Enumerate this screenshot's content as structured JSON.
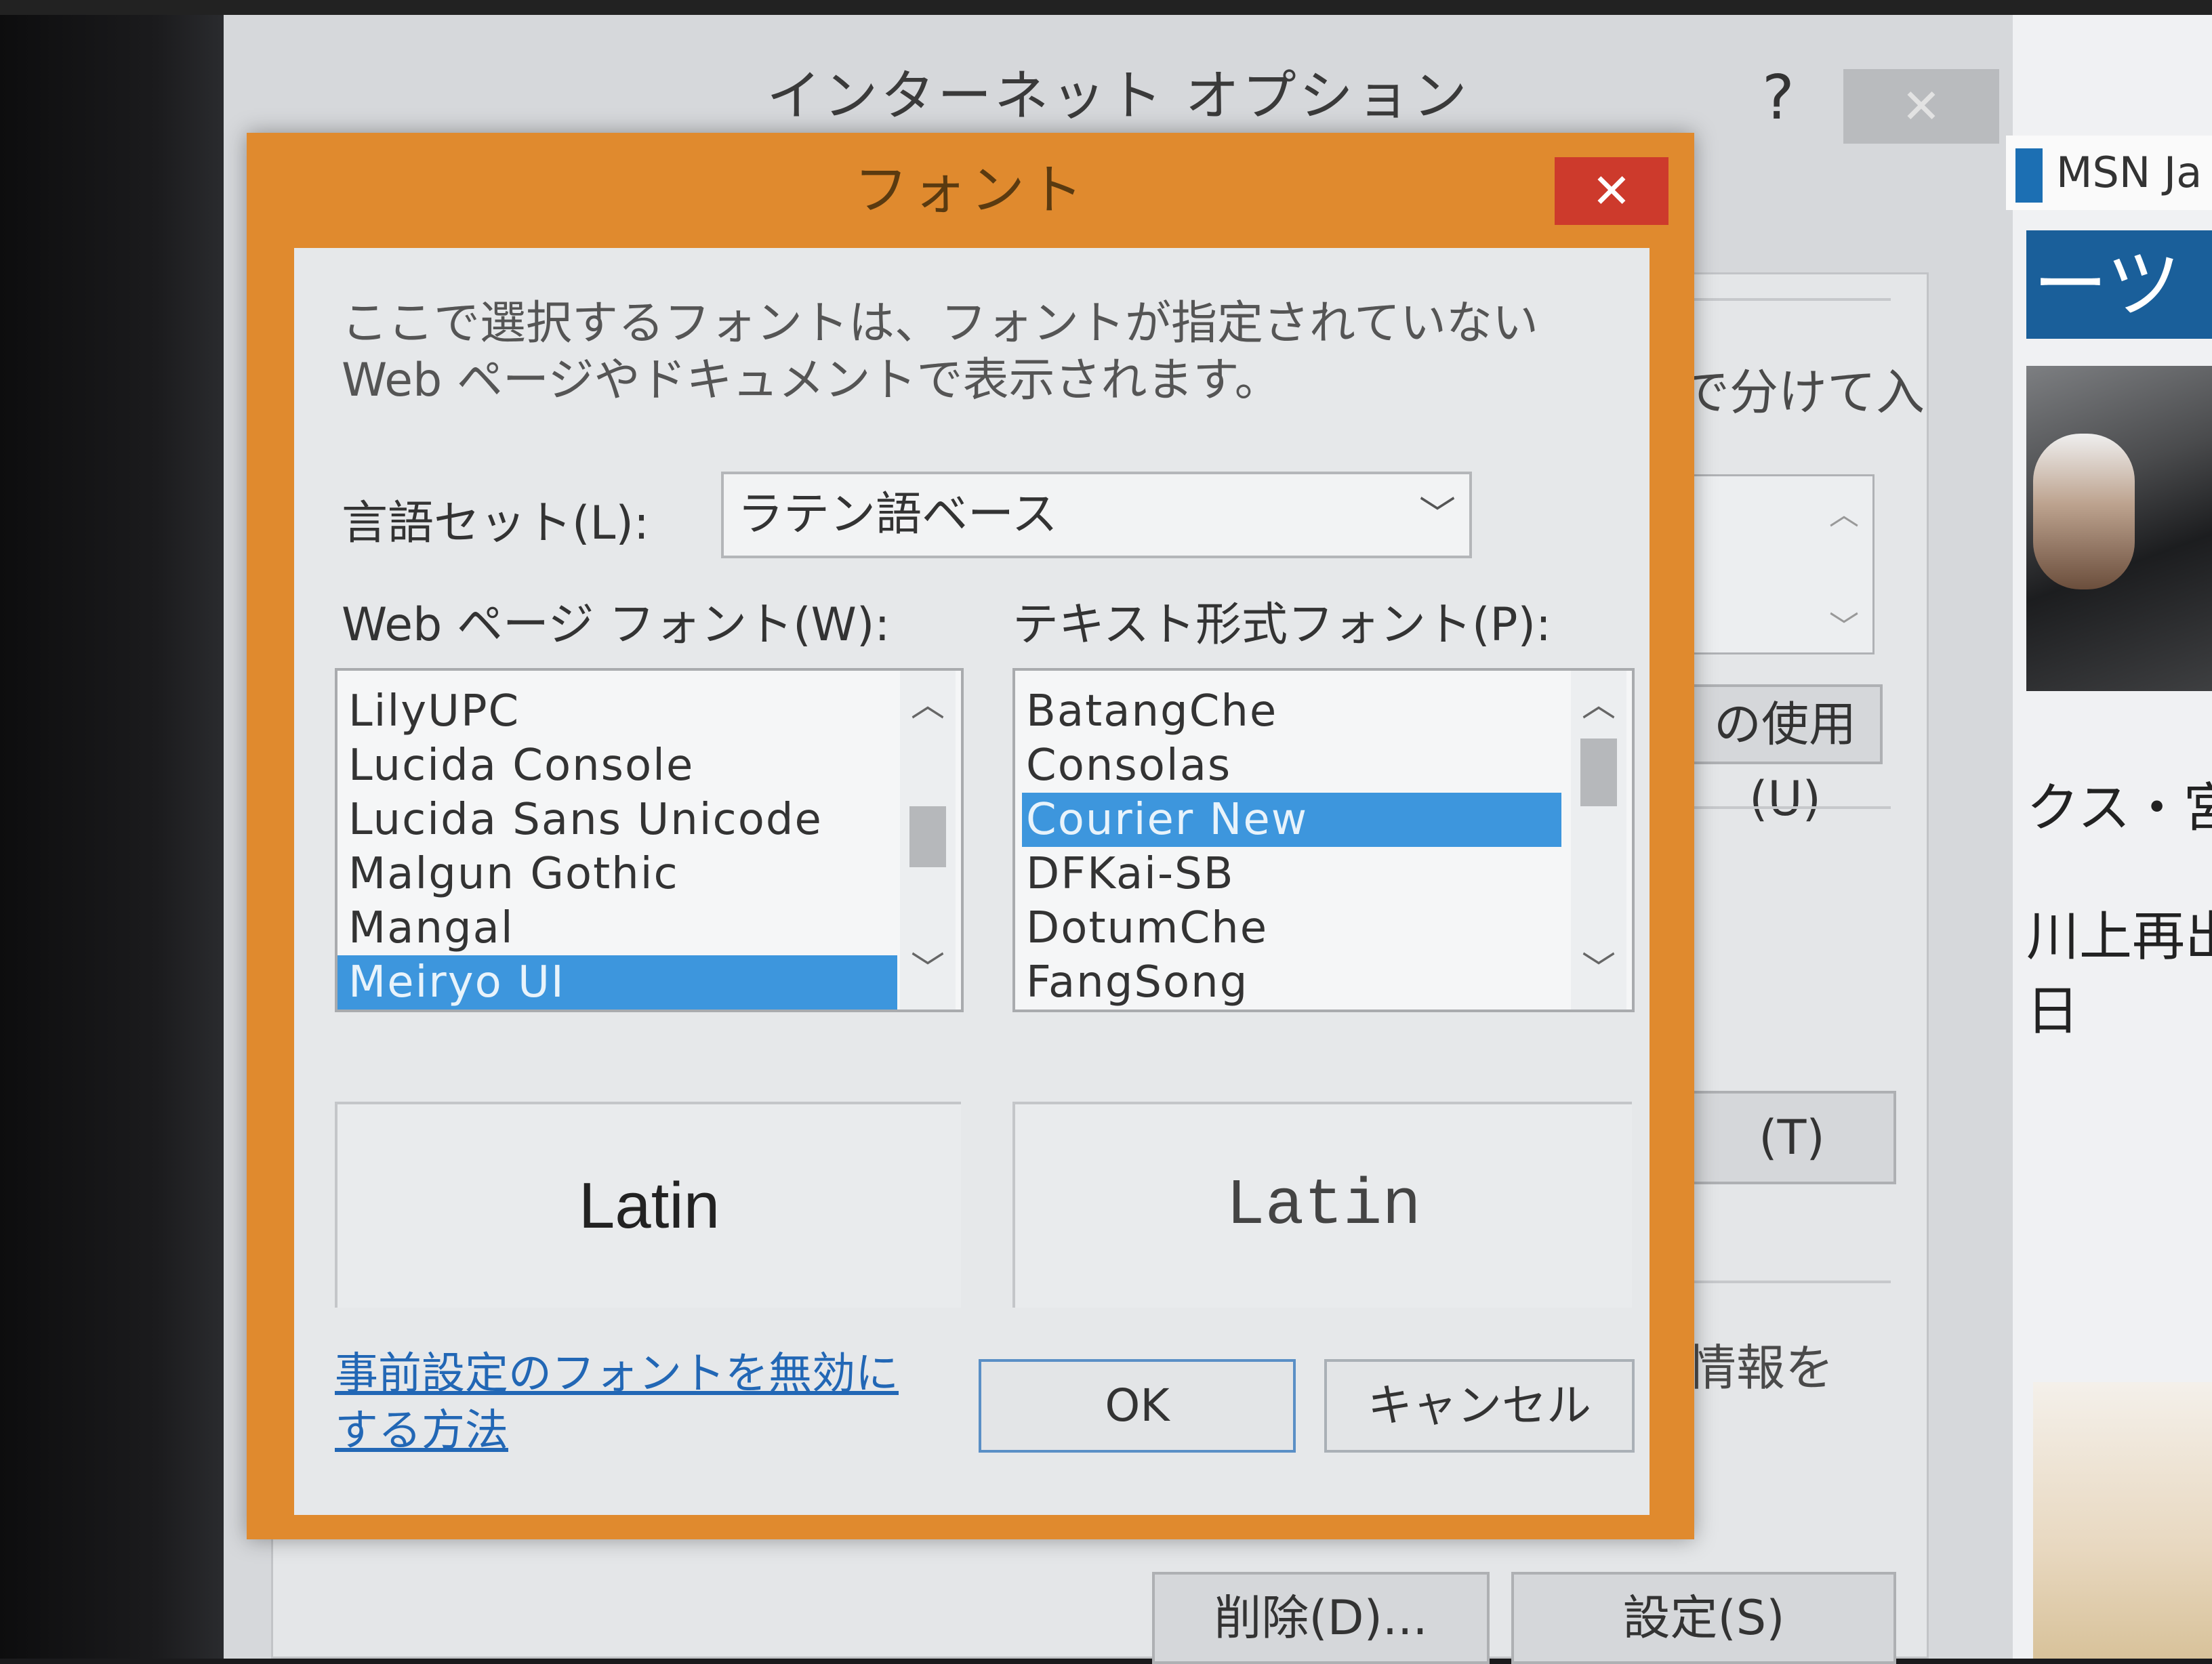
{
  "parent_window": {
    "title": "インターネット オプション",
    "help_label": "?",
    "close_label": "✕",
    "fragments": {
      "separate_text": "で分けて入",
      "use_button": "の使用(U)",
      "t_button": "(T)",
      "info_text": "情報を",
      "delete_button": "削除(D)...",
      "settings_button": "設定(S)"
    }
  },
  "browser": {
    "msn_label": "MSN Ja",
    "blue_band_text": "ーツ",
    "text_1": "クス・宮",
    "text_2": "川上再出",
    "text_3": "日"
  },
  "dialog": {
    "title": "フォント",
    "close_label": "✕",
    "description": "ここで選択するフォントは、フォントが指定されていない Web ページやドキュメントで表示されます。",
    "language_set_label": "言語セット(L):",
    "language_set_value": "ラテン語ベース",
    "web_font_label": "Web ページ フォント(W):",
    "text_font_label": "テキスト形式フォント(P):",
    "web_fonts": [
      "LilyUPC",
      "Lucida Console",
      "Lucida Sans Unicode",
      "Malgun Gothic",
      "Mangal",
      "Meiryo UI"
    ],
    "web_fonts_selected": "Meiryo UI",
    "text_fonts": [
      "BatangChe",
      "Consolas",
      "Courier New",
      "DFKai-SB",
      "DotumChe",
      "FangSong"
    ],
    "text_fonts_selected": "Courier New",
    "web_preview": "Latin",
    "text_preview": "Latin",
    "help_link_line1": "事前設定のフォントを無効に",
    "help_link_line2": "する方法",
    "ok_label": "OK",
    "cancel_label": "キャンセル"
  },
  "colors": {
    "dialog_frame": "#e08a2e",
    "close_button": "#cd3a2c",
    "selection": "#3d96dd",
    "link": "#2267b5"
  }
}
